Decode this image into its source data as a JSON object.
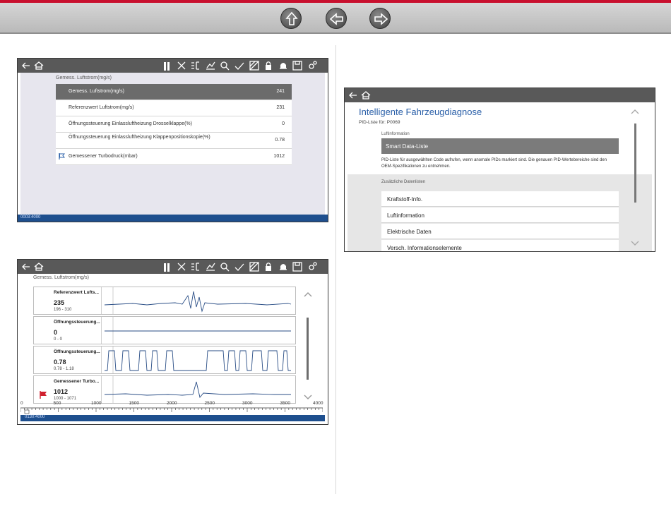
{
  "nav": {
    "buttons": [
      {
        "icon": "up-arrow-icon"
      },
      {
        "icon": "left-arrow-icon"
      },
      {
        "icon": "right-arrow-icon"
      }
    ]
  },
  "screen1": {
    "toolbar_icons": [
      "back-arrow-icon",
      "home-icon",
      "pause-icon",
      "close-icon",
      "pid-select-icon",
      "graph-icon",
      "zoom-icon",
      "check-icon",
      "data-view-icon",
      "lock-icon",
      "bell-icon",
      "save-icon",
      "settings-icon"
    ],
    "page_title": "Gemess. Luftstrom(mg/s)",
    "rows": [
      {
        "name": "Gemess. Luftstrom(mg/s)",
        "value": "241",
        "selected": true,
        "flag": false
      },
      {
        "name": "Referenzwert Luftstrom(mg/s)",
        "value": "231",
        "selected": false,
        "flag": false
      },
      {
        "name": "Öffnungssteuerung Einlassluftheizung Drosselklappe(%)",
        "value": "0",
        "selected": false,
        "flag": false
      },
      {
        "name": "Öffnungssteuerung Einlassluftheizung Klappenpositionskopie(%)",
        "value": "0.78",
        "selected": false,
        "flag": false
      },
      {
        "name": "Gemessener Turbodruck(mbar)",
        "value": "1012",
        "selected": false,
        "flag": true
      }
    ],
    "status_time": "0003:4000"
  },
  "screen2": {
    "page_title": "Gemess. Luftstrom(mg/s)",
    "graphs": [
      {
        "name": "Referenzwert Lufts...",
        "value": "235",
        "range": "196 - 310",
        "flag": false
      },
      {
        "name": "Öffnungssteuerung...",
        "value": "0",
        "range": "0 - 0",
        "flag": false
      },
      {
        "name": "Öffnungssteuerung...",
        "value": "0.78",
        "range": "0.78 - 1.18",
        "flag": false
      },
      {
        "name": "Gemessener Turbo...",
        "value": "1012",
        "range": "1000 - 1071",
        "flag": true
      }
    ],
    "axis_ticks": [
      "0",
      "500",
      "1000",
      "1500",
      "2000",
      "2500",
      "3000",
      "3500",
      "4000"
    ],
    "status_time": "0130:4000",
    "accent_flag_color": "#d0202e"
  },
  "screen3": {
    "title": "Intelligente Fahrzeugdiagnose",
    "subtitle": "PID-Liste für: P0069",
    "section1_label": "Luftinformation",
    "smart_item": "Smart Data-Liste",
    "description": "PID-Liste für ausgewählten Code aufrufen, wenn anomale PIDs markiert sind. Die genauen PID-Wertebereiche sind den OEM-Spezifikationen zu entnehmen.",
    "section2_label": "Zusätzliche Datenlisten",
    "items": [
      "Kraftstoff-Info.",
      "Luftinformation",
      "Elektrische Daten",
      "Versch. Informationselemente"
    ]
  }
}
